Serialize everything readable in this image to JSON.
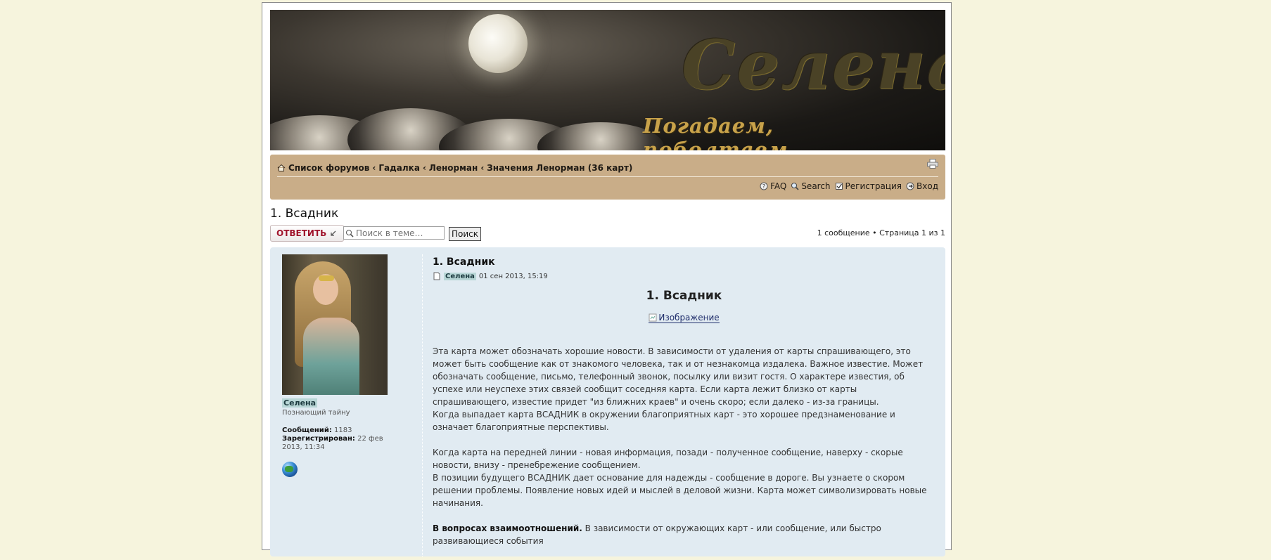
{
  "banner": {
    "title": "Селена",
    "subtitle": "Погадаем, поболтаем....."
  },
  "nav": {
    "crumbs": [
      "Список форумов",
      "Гадалка",
      "Ленорман",
      "Значения Ленорман (36 карт)"
    ],
    "separator": "‹",
    "links": {
      "faq": "FAQ",
      "search": "Search",
      "register": "Регистрация",
      "login": "Вход"
    }
  },
  "topic": {
    "title": "1. Всадник",
    "reply_label": "ОТВЕТИТЬ",
    "search_placeholder": "Поиск в теме…",
    "search_button": "Поиск",
    "pagination": "1 сообщение • Страница 1 из 1"
  },
  "post": {
    "title": "1. Всадник",
    "author": "Селена",
    "date": "01 сен 2013, 15:19",
    "content_title": "1. Всадник",
    "image_alt": "Изображение",
    "paragraph1": "Эта карта может обозначать хорошие новости. В зависимости от удаления от карты спрашивающего, это может быть сообщение как от знакомого человека, так и от незнакомца издалека. Важное известие. Может обозначать сообщение, письмо, телефонный звонок, посылку или визит гостя. О характере известия, об успехе или неуспехе этих связей сообщит соседняя карта. Если карта лежит близко от карты спрашивающего, известие придет \"из ближних краев\" и очень скоро; если далеко - из-за границы.",
    "paragraph1b": "Когда выпадает карта ВСАДНИК в окружении благоприятных карт - это хорошее предзнаменование и означает благоприятные перспективы.",
    "paragraph2": "Когда карта на передней линии - новая информация, позади - полученное сообщение, наверху - скорые новости, внизу - пренебрежение сообщением.",
    "paragraph2b": "В позиции будущего ВСАДНИК дает основание для надежды - сообщение в дороге. Вы узнаете о скором решении проблемы. Появление новых идей и мыслей в деловой жизни. Карта может символизировать новые начинания.",
    "paragraph3_bold": "В вопросах взаимоотношений.",
    "paragraph3": " В зависимости от окружающих карт - или сообщение, или быстро развивающиеся события"
  },
  "profile": {
    "username": "Селена",
    "rank": "Познающий тайну",
    "posts_label": "Сообщений:",
    "posts_value": "1183",
    "registered_label": "Зарегистрирован:",
    "registered_value": "22 фев 2013, 11:34"
  },
  "colors": {
    "page_bg": "#f6f4dd",
    "nav_bg": "#c9ad88",
    "post_bg": "#e1ebf2",
    "reply_red": "#a0132b"
  }
}
